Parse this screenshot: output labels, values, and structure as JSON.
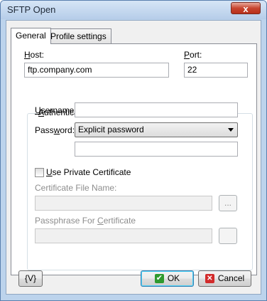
{
  "window": {
    "title": "SFTP Open",
    "close_glyph": "x"
  },
  "tabs": [
    {
      "label": "General",
      "active": true
    },
    {
      "label": "Profile settings",
      "active": false
    }
  ],
  "host": {
    "label_u": "H",
    "label_rest": "ost:",
    "value": "ftp.company.com"
  },
  "port": {
    "label_u": "P",
    "label_rest": "ort:",
    "value": "22"
  },
  "auth": {
    "group_label_u": "A",
    "group_label_rest": "uthentication",
    "username": {
      "label_u": "U",
      "label_rest": "sername:",
      "value": ""
    },
    "password": {
      "label_pre": "Pass",
      "label_u": "w",
      "label_rest": "ord:",
      "selected": "Explicit password",
      "value": ""
    },
    "use_private_cert": {
      "label_u": "U",
      "label_rest": "se Private Certificate",
      "checked": false
    },
    "cert_file": {
      "label": "Certificate File Name:",
      "value": "",
      "browse": "..."
    },
    "passphrase": {
      "label_pre": "Passphrase For ",
      "label_u": "C",
      "label_rest": "ertificate",
      "value": ""
    }
  },
  "footer": {
    "variable_button": "{V}",
    "ok_button": "OK",
    "cancel_button": "Cancel",
    "ok_icon": "check-icon",
    "cancel_icon": "x-icon"
  },
  "colors": {
    "title_bar": "#c4d8ef",
    "close_button": "#c7452f",
    "ok_icon": "#2f9a2f",
    "cancel_icon": "#d22b2b"
  }
}
